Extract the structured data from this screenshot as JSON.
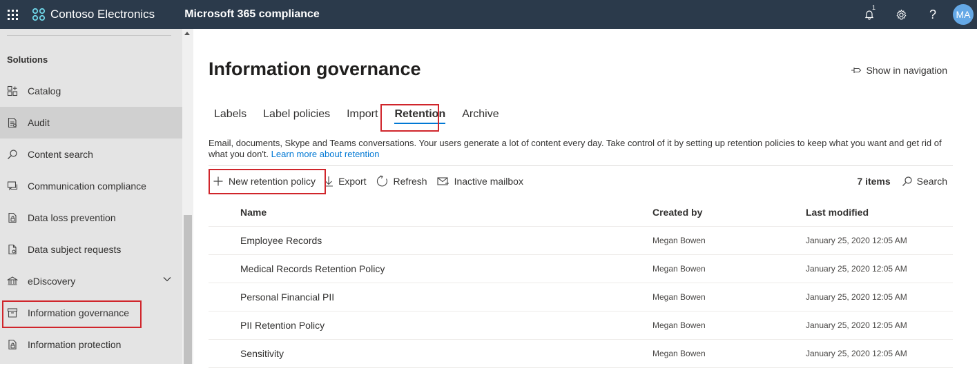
{
  "topbar": {
    "brand": "Contoso Electronics",
    "app": "Microsoft 365 compliance",
    "notification_count": "1",
    "avatar_initials": "MA",
    "background": "#2b3a4b"
  },
  "sidebar": {
    "heading": "Solutions",
    "items": [
      {
        "label": "Catalog",
        "icon": "catalog-icon"
      },
      {
        "label": "Audit",
        "icon": "audit-icon"
      },
      {
        "label": "Content search",
        "icon": "search-icon"
      },
      {
        "label": "Communication compliance",
        "icon": "chat-icon"
      },
      {
        "label": "Data loss prevention",
        "icon": "lock-doc-icon"
      },
      {
        "label": "Data subject requests",
        "icon": "doc-icon"
      },
      {
        "label": "eDiscovery",
        "icon": "ediscovery-icon"
      },
      {
        "label": "Information governance",
        "icon": "archive-icon"
      },
      {
        "label": "Information protection",
        "icon": "lock-doc-icon"
      }
    ]
  },
  "main": {
    "title": "Information governance",
    "show_in_navigation": "Show in navigation",
    "tabs": [
      "Labels",
      "Label policies",
      "Import",
      "Retention",
      "Archive"
    ],
    "selected_tab": "Retention",
    "description": "Email, documents, Skype and Teams conversations. Your users generate a lot of content every day. Take control of it by setting up retention policies to keep what you want and get rid of what you don't.",
    "learn_more": "Learn more about retention",
    "toolbar": {
      "new_policy": "New retention policy",
      "export": "Export",
      "refresh": "Refresh",
      "inactive_mailbox": "Inactive mailbox",
      "item_count": "7 items",
      "search": "Search"
    },
    "table": {
      "columns": [
        "Name",
        "Created by",
        "Last modified"
      ],
      "rows": [
        {
          "name": "Employee Records",
          "created_by": "Megan Bowen",
          "modified": "January 25, 2020 12:05 AM"
        },
        {
          "name": "Medical Records Retention Policy",
          "created_by": "Megan Bowen",
          "modified": "January 25, 2020 12:05 AM"
        },
        {
          "name": "Personal Financial PII",
          "created_by": "Megan Bowen",
          "modified": "January 25, 2020 12:05 AM"
        },
        {
          "name": "PII Retention Policy",
          "created_by": "Megan Bowen",
          "modified": "January 25, 2020 12:05 AM"
        },
        {
          "name": "Sensitivity",
          "created_by": "Megan Bowen",
          "modified": "January 25, 2020 12:05 AM"
        }
      ]
    }
  },
  "colors": {
    "accent": "#0078d4",
    "highlight": "#d0252b",
    "sidebar": "#e4e4e4"
  }
}
